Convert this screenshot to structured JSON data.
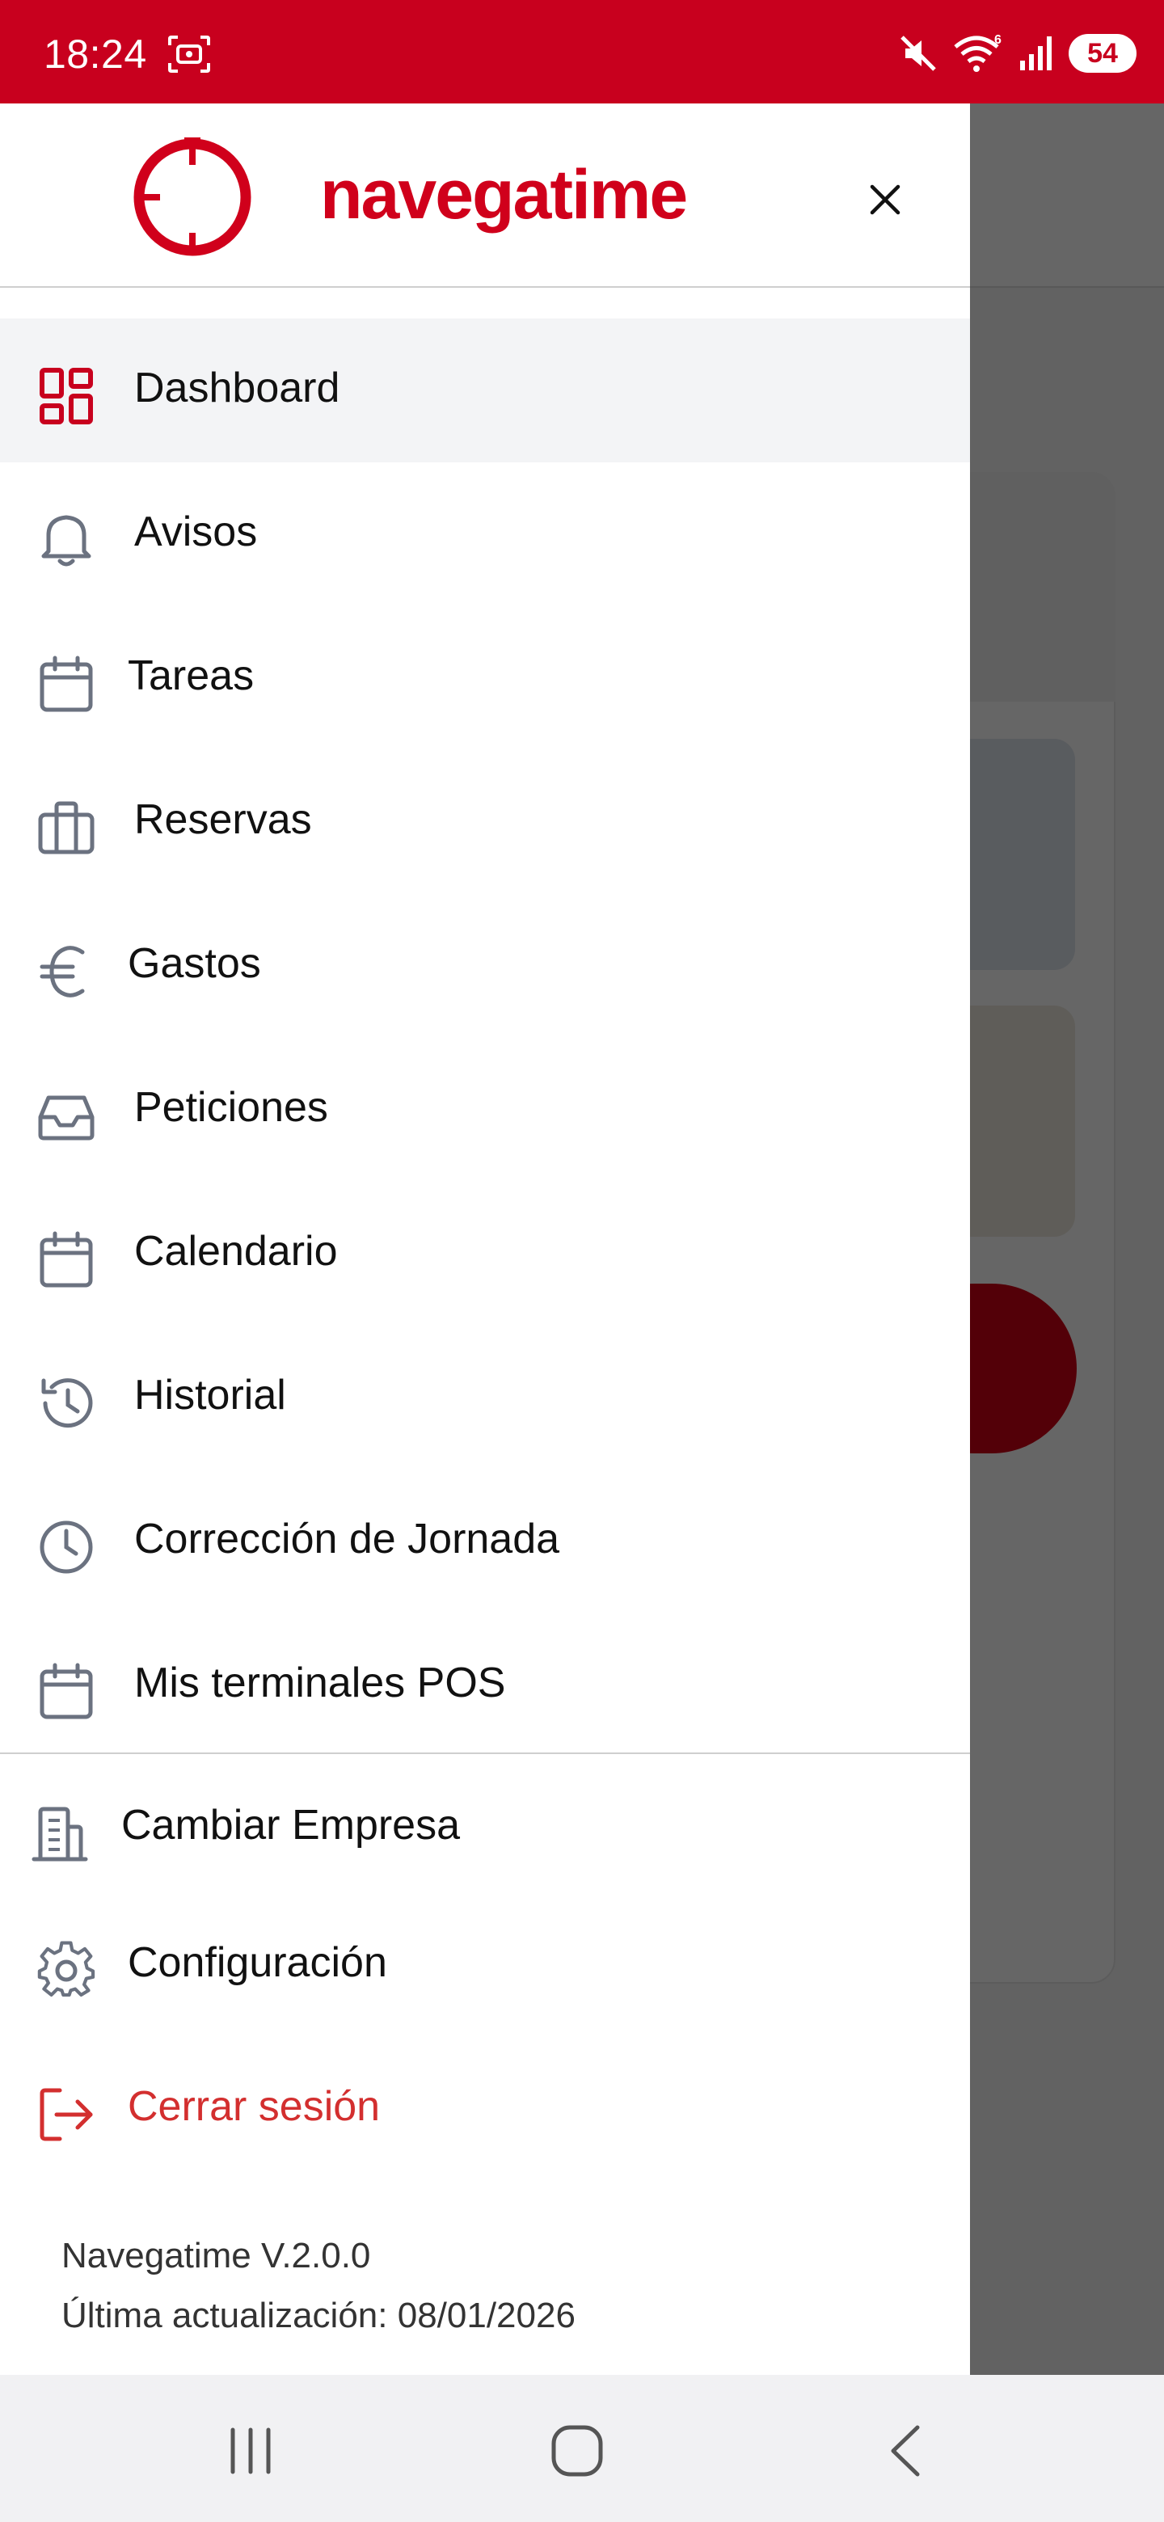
{
  "status_bar": {
    "time": "18:24",
    "battery": "54",
    "wifi_badge": "6",
    "icons": [
      "screenshot-icon",
      "mute-icon",
      "wifi-icon",
      "signal-icon",
      "battery-icon"
    ]
  },
  "drawer": {
    "logo_text": "navegatime",
    "close_icon": "close-icon",
    "menu": [
      {
        "label": "Dashboard",
        "icon": "dashboard-icon",
        "active": true
      },
      {
        "label": "Avisos",
        "icon": "bell-icon"
      },
      {
        "label": "Tareas",
        "icon": "calendar-icon"
      },
      {
        "label": "Reservas",
        "icon": "briefcase-icon"
      },
      {
        "label": "Gastos",
        "icon": "euro-icon"
      },
      {
        "label": "Peticiones",
        "icon": "inbox-icon"
      },
      {
        "label": "Calendario",
        "icon": "calendar-icon"
      },
      {
        "label": "Historial",
        "icon": "history-icon"
      },
      {
        "label": "Corrección de Jornada",
        "icon": "clock-icon"
      },
      {
        "label": "Mis terminales POS",
        "icon": "calendar-icon"
      }
    ],
    "secondary": [
      {
        "label": "Cambiar Empresa",
        "icon": "building-icon"
      },
      {
        "label": "Configuración",
        "icon": "gear-icon"
      },
      {
        "label": "Cerrar sesión",
        "icon": "logout-icon"
      }
    ],
    "footer": {
      "version": "Navegatime V.2.0.0",
      "last_update": "Última actualización: 08/01/2026"
    }
  },
  "colors": {
    "brand_red": "#c8001e",
    "logout_red": "#d32f2f",
    "icon_gray": "#6b7280",
    "active_bg": "#f3f4f6"
  },
  "nav_bar": {
    "buttons": [
      "recent-apps-icon",
      "home-icon",
      "back-icon"
    ]
  }
}
